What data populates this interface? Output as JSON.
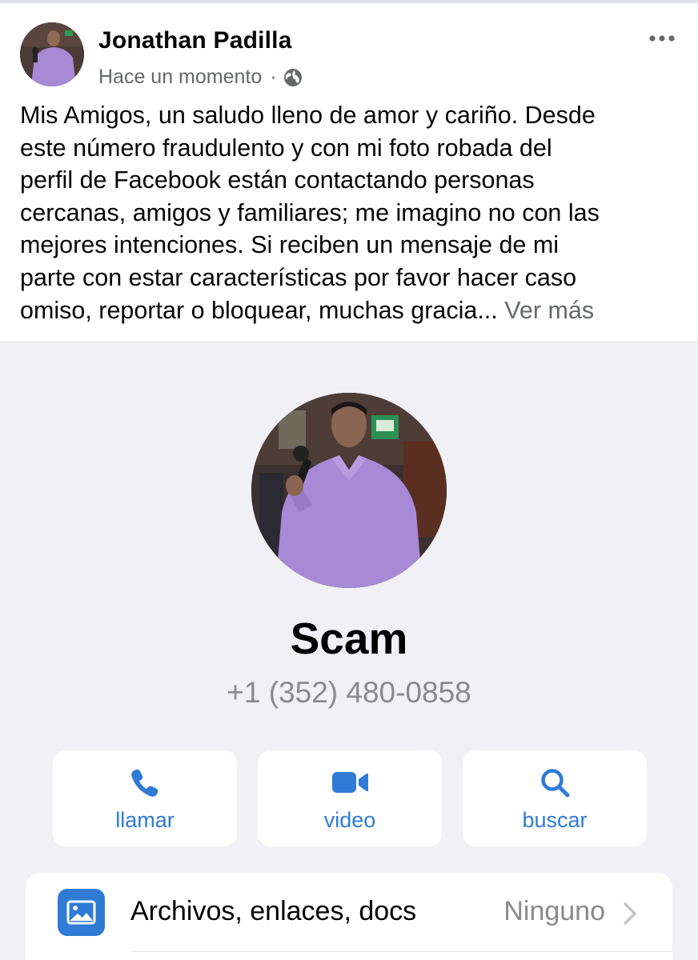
{
  "post": {
    "author_name": "Jonathan Padilla",
    "timestamp": "Hace un momento",
    "separator": "·",
    "privacy_icon": "globe-icon",
    "menu_icon": "more-horizontal-icon",
    "text_lines": [
      "Mis Amigos, un saludo lleno de amor y cariño.  Desde",
      "este número fraudulento y con mi foto robada del",
      "perfil de Facebook están contactando personas",
      "cercanas, amigos y familiares; me imagino no con las",
      "mejores intenciones.  Si reciben un mensaje de mi",
      "parte con estar características por favor hacer caso",
      "omiso, reportar o bloquear, muchas gracia..."
    ],
    "see_more": "Ver más"
  },
  "contact": {
    "name": "Scam",
    "phone": "+1 (352) 480-0858",
    "actions": [
      {
        "label": "llamar",
        "icon": "phone-icon"
      },
      {
        "label": "video",
        "icon": "video-camera-icon"
      },
      {
        "label": "buscar",
        "icon": "search-icon"
      }
    ],
    "files_row": {
      "label": "Archivos, enlaces, docs",
      "value": "Ninguno",
      "icon": "photo-icon"
    }
  },
  "colors": {
    "accent_blue": "#2f7bd6",
    "secondary_text": "#65676b",
    "contact_background": "#f1f0f5",
    "shirt_purple": "#a889d6"
  }
}
